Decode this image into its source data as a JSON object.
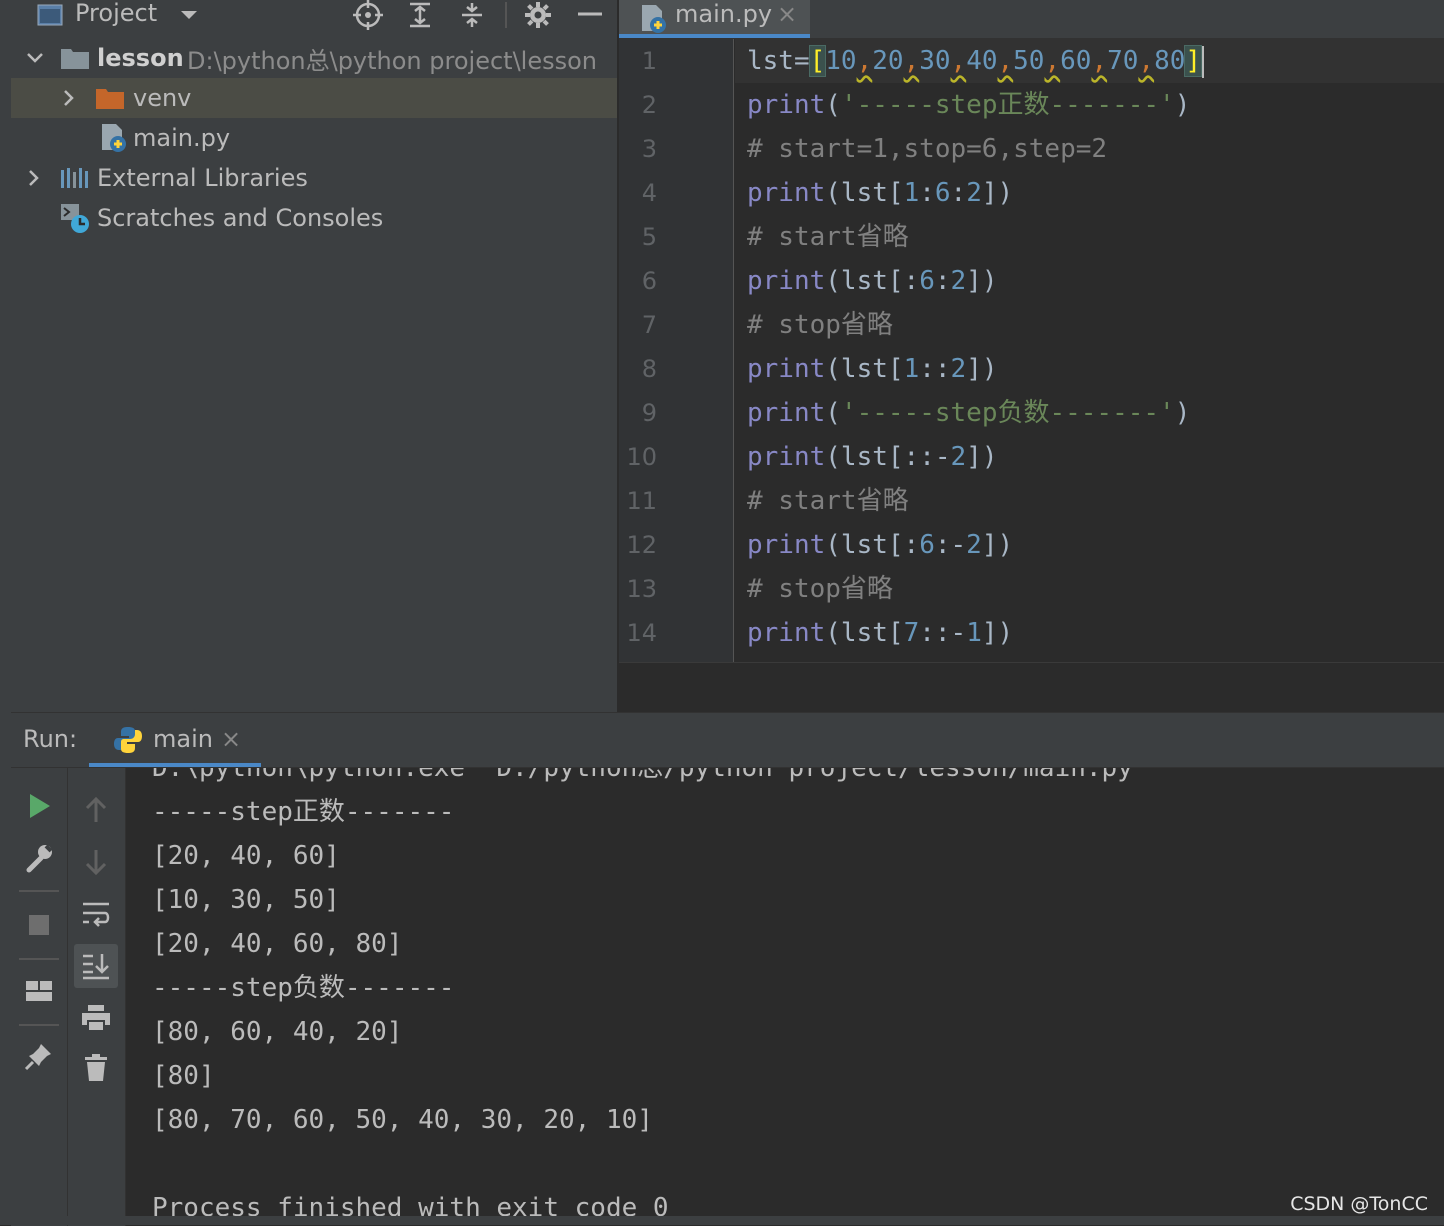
{
  "project_panel": {
    "title": "Project",
    "tree": [
      {
        "label": "lesson",
        "path": "D:\\python总\\python project\\lesson"
      },
      {
        "label": "venv"
      },
      {
        "label": "main.py"
      },
      {
        "label": "External Libraries"
      },
      {
        "label": "Scratches and Consoles"
      }
    ]
  },
  "editor": {
    "tab": {
      "label": "main.py",
      "close": "×"
    },
    "line_numbers": [
      "1",
      "2",
      "3",
      "4",
      "5",
      "6",
      "7",
      "8",
      "9",
      "10",
      "11",
      "12",
      "13",
      "14"
    ],
    "lines": [
      [
        {
          "t": "lst=",
          "c": "op"
        },
        {
          "t": "[",
          "c": "bracket-hl"
        },
        {
          "t": "10",
          "c": "num"
        },
        {
          "t": ",",
          "c": "comma"
        },
        {
          "t": "20",
          "c": "num"
        },
        {
          "t": ",",
          "c": "comma"
        },
        {
          "t": "30",
          "c": "num"
        },
        {
          "t": ",",
          "c": "comma"
        },
        {
          "t": "40",
          "c": "num"
        },
        {
          "t": ",",
          "c": "comma"
        },
        {
          "t": "50",
          "c": "num"
        },
        {
          "t": ",",
          "c": "comma"
        },
        {
          "t": "60",
          "c": "num"
        },
        {
          "t": ",",
          "c": "comma"
        },
        {
          "t": "70",
          "c": "num"
        },
        {
          "t": ",",
          "c": "comma"
        },
        {
          "t": "80",
          "c": "num"
        },
        {
          "t": "]",
          "c": "bracket-hl"
        }
      ],
      [
        {
          "t": "print",
          "c": "fn"
        },
        {
          "t": "(",
          "c": "op"
        },
        {
          "t": "'-----step正数-------'",
          "c": "str"
        },
        {
          "t": ")",
          "c": "op"
        }
      ],
      [
        {
          "t": "# start=1,stop=6,step=2",
          "c": "cmt"
        }
      ],
      [
        {
          "t": "print",
          "c": "fn"
        },
        {
          "t": "(lst[",
          "c": "op"
        },
        {
          "t": "1",
          "c": "num"
        },
        {
          "t": ":",
          "c": "op"
        },
        {
          "t": "6",
          "c": "num"
        },
        {
          "t": ":",
          "c": "op"
        },
        {
          "t": "2",
          "c": "num"
        },
        {
          "t": "])",
          "c": "op"
        }
      ],
      [
        {
          "t": "# start省略",
          "c": "cmt"
        }
      ],
      [
        {
          "t": "print",
          "c": "fn"
        },
        {
          "t": "(lst[:",
          "c": "op"
        },
        {
          "t": "6",
          "c": "num"
        },
        {
          "t": ":",
          "c": "op"
        },
        {
          "t": "2",
          "c": "num"
        },
        {
          "t": "])",
          "c": "op"
        }
      ],
      [
        {
          "t": "# stop省略",
          "c": "cmt"
        }
      ],
      [
        {
          "t": "print",
          "c": "fn"
        },
        {
          "t": "(lst[",
          "c": "op"
        },
        {
          "t": "1",
          "c": "num"
        },
        {
          "t": "::",
          "c": "op"
        },
        {
          "t": "2",
          "c": "num"
        },
        {
          "t": "])",
          "c": "op"
        }
      ],
      [
        {
          "t": "print",
          "c": "fn"
        },
        {
          "t": "(",
          "c": "op"
        },
        {
          "t": "'-----step负数-------'",
          "c": "str"
        },
        {
          "t": ")",
          "c": "op"
        }
      ],
      [
        {
          "t": "print",
          "c": "fn"
        },
        {
          "t": "(lst[::-",
          "c": "op"
        },
        {
          "t": "2",
          "c": "num"
        },
        {
          "t": "])",
          "c": "op"
        }
      ],
      [
        {
          "t": "# start省略",
          "c": "cmt"
        }
      ],
      [
        {
          "t": "print",
          "c": "fn"
        },
        {
          "t": "(lst[:",
          "c": "op"
        },
        {
          "t": "6",
          "c": "num"
        },
        {
          "t": ":-",
          "c": "op"
        },
        {
          "t": "2",
          "c": "num"
        },
        {
          "t": "])",
          "c": "op"
        }
      ],
      [
        {
          "t": "# stop省略",
          "c": "cmt"
        }
      ],
      [
        {
          "t": "print",
          "c": "fn"
        },
        {
          "t": "(lst[",
          "c": "op"
        },
        {
          "t": "7",
          "c": "num"
        },
        {
          "t": "::-",
          "c": "op"
        },
        {
          "t": "1",
          "c": "num"
        },
        {
          "t": "])",
          "c": "op"
        }
      ]
    ]
  },
  "run_panel": {
    "label": "Run:",
    "tab": {
      "label": "main",
      "close": "×"
    },
    "console_lines": [
      "D:\\python\\python.exe  D:/python总/python project/lesson/main.py",
      "-----step正数-------",
      "[20, 40, 60]",
      "[10, 30, 50]",
      "[20, 40, 60, 80]",
      "-----step负数-------",
      "[80, 60, 40, 20]",
      "[80]",
      "[80, 70, 60, 50, 40, 30, 20, 10]",
      "",
      "Process finished with exit code 0"
    ]
  },
  "watermark": "CSDN @TonCC",
  "colors": {
    "keyword_fn": "#8888c6",
    "string": "#6a8759",
    "number": "#6897bb",
    "comment": "#808080",
    "comma": "#cc7832",
    "accent": "#4a88c7"
  }
}
